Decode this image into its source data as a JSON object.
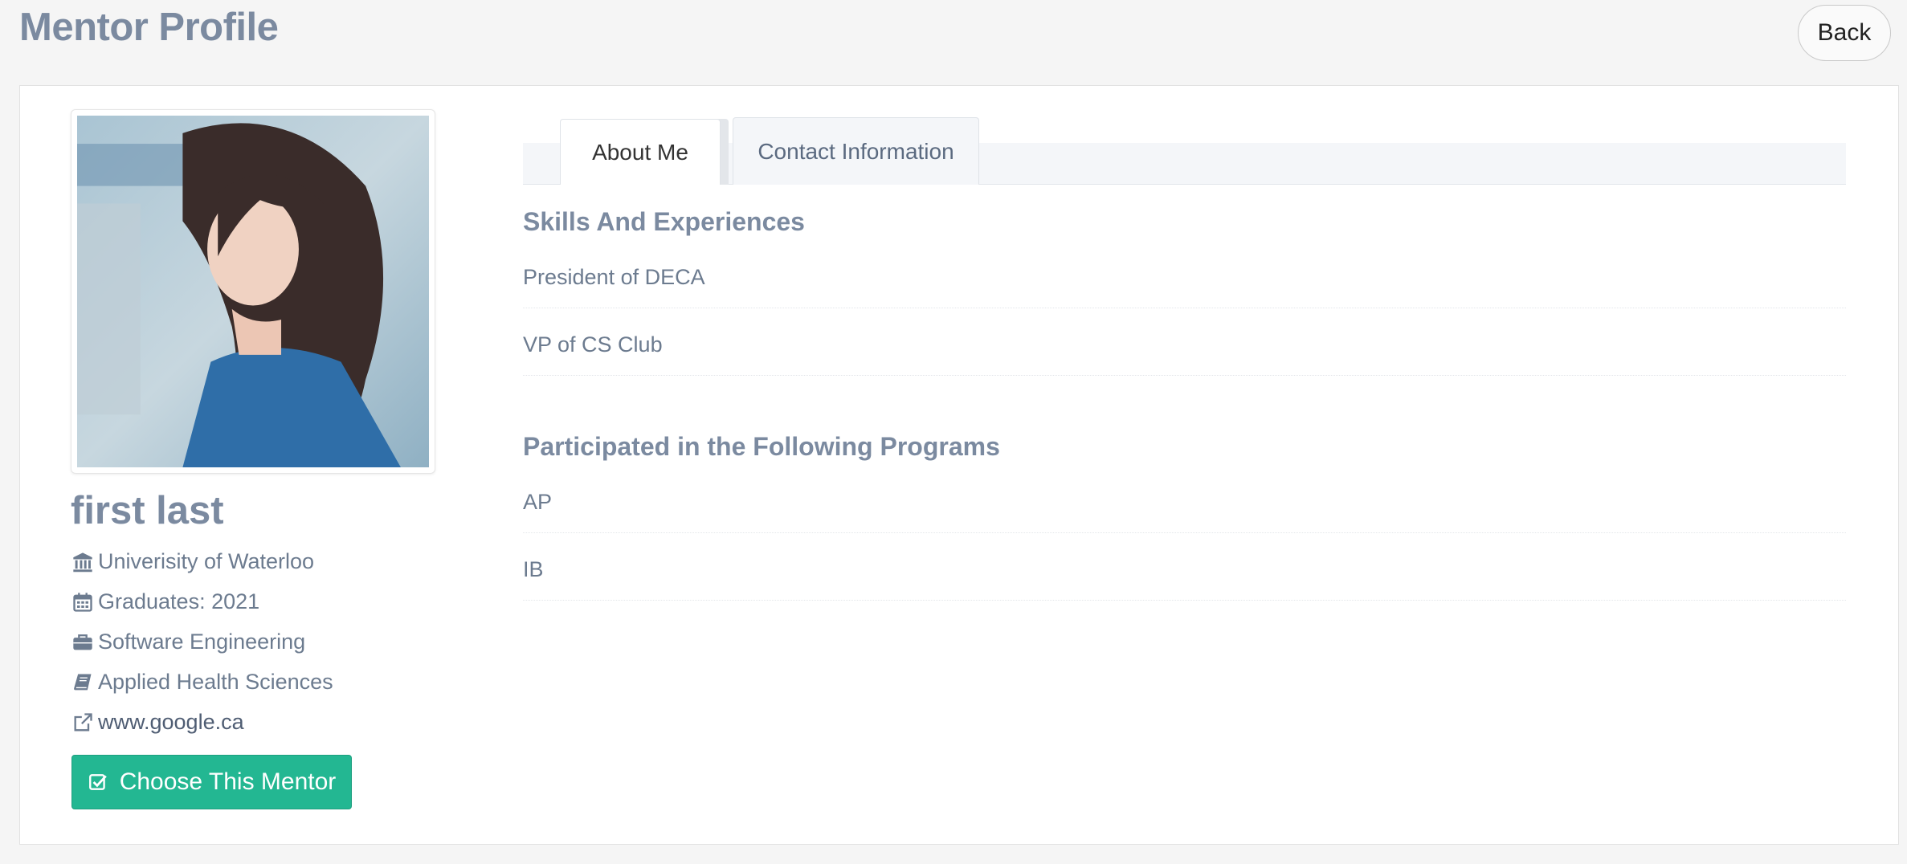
{
  "header": {
    "title": "Mentor Profile",
    "back_label": "Back"
  },
  "profile": {
    "photo_alt": "mentor photo",
    "name": "first last",
    "university": "Univerisity of Waterloo",
    "graduates": "Graduates: 2021",
    "program": "Software Engineering",
    "faculty": "Applied Health Sciences",
    "website": "www.google.ca",
    "choose_label": "Choose This Mentor"
  },
  "tabs": [
    {
      "label": "About Me",
      "active": true
    },
    {
      "label": "Contact Information",
      "active": false
    }
  ],
  "about": {
    "skills_heading": "Skills And Experiences",
    "skills": [
      "President of DECA",
      "VP of CS Club"
    ],
    "programs_heading": "Participated in the Following Programs",
    "programs": [
      "AP",
      "IB"
    ]
  },
  "colors": {
    "accent_green": "#23b792",
    "heading": "#7b8aa0",
    "text": "#6c7b8f"
  },
  "icons": {
    "university": "institution-icon",
    "graduates": "calendar-icon",
    "program": "briefcase-icon",
    "faculty": "book-icon",
    "website": "external-link-icon",
    "choose": "check-square-icon"
  }
}
